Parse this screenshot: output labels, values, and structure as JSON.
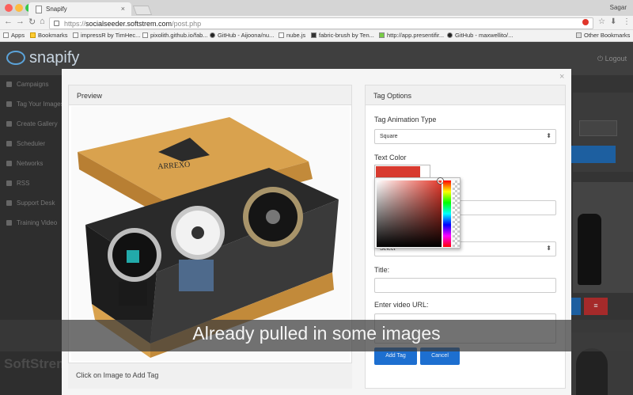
{
  "browser": {
    "tab_title": "Snapify",
    "user_name": "Sagar",
    "url_scheme": "https://",
    "url_host": "socialseeder.softstrem.com",
    "url_path": "/post.php",
    "bookmarks": [
      "Apps",
      "Bookmarks",
      "impressR by TimHec...",
      "pixolith.github.io/fab...",
      "GitHub - Aijoona/nu...",
      "nube.js",
      "fabric-brush by Ten...",
      "http://app.presentifir...",
      "GitHub - maxwellito/..."
    ],
    "other_bookmarks": "Other Bookmarks"
  },
  "app": {
    "logo": "snapify",
    "logout": "Logout",
    "sidebar": [
      "Campaigns",
      "Tag Your Images",
      "Create Gallery",
      "Scheduler",
      "Networks",
      "RSS",
      "Support Desk",
      "Training Video"
    ],
    "watermark": "SoftStrem"
  },
  "modal": {
    "close": "×",
    "preview_title": "Preview",
    "preview_footer": "Click on Image to Add Tag",
    "image_brand": "ARREXO",
    "tag_options_title": "Tag Options",
    "animation_label": "Tag Animation Type",
    "animation_value": "Square",
    "text_color_label": "Text Color",
    "text_color": "#d83a2f",
    "select_value": "Select",
    "title_label": "Title:",
    "video_label": "Enter video URL:",
    "add_tag": "Add Tag",
    "cancel": "Cancel"
  },
  "caption": "Already pulled in some images",
  "colors": {
    "accent": "#1d6fd0",
    "danger": "#a52a2a"
  }
}
